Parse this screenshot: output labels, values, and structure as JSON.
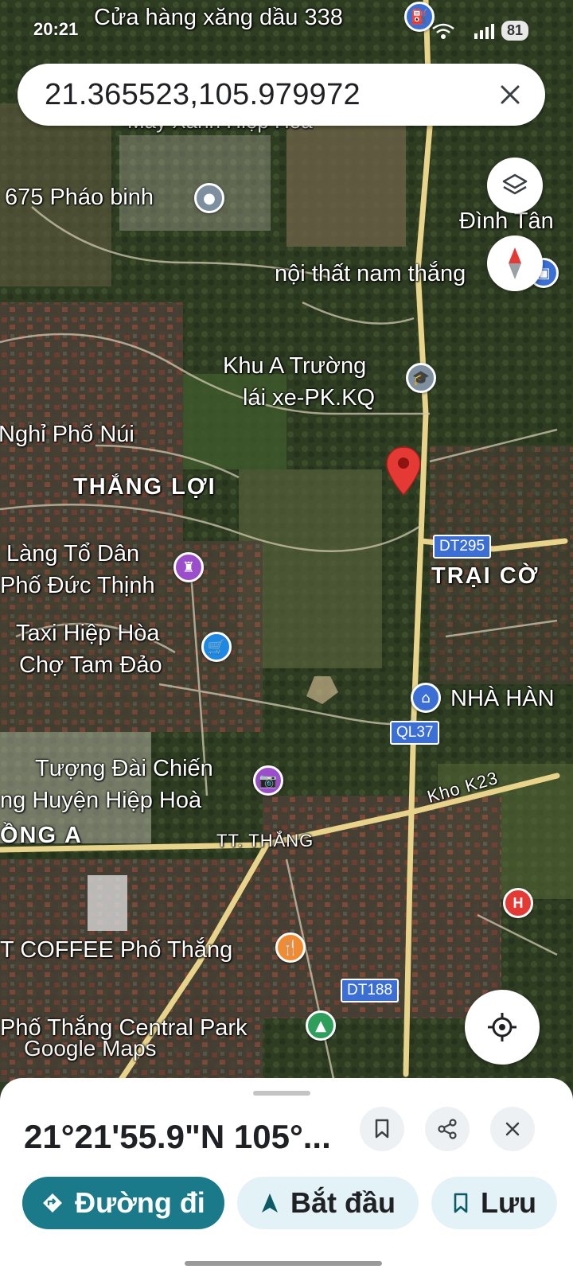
{
  "status": {
    "time": "20:21",
    "battery": "81"
  },
  "search": {
    "query": "21.365523,105.979972"
  },
  "map": {
    "watermark": "Google Maps",
    "labels": {
      "gas_station": "Cửa hàng xăng dầu 338",
      "may_xanh": "Máy Xanh Hiệp Hòa",
      "phao_binh": "675 Pháo binh",
      "dinh_tan": "Đình Tân",
      "noi_that": "nội thất nam thắng",
      "khu_a_line1": "Khu A Trường",
      "khu_a_line2": "lái xe-PK.KQ",
      "nghi_pho_nui": "Nghỉ Phố Núi",
      "thang_loi": "THẮNG LỢI",
      "lang_to_dan_line1": "Làng Tổ Dân",
      "lang_to_dan_line2": "Phố Đức Thịnh",
      "trai_co": "TRẠI CỜ",
      "taxi": "Taxi Hiệp Hòa",
      "cho_tam_dao": "Chợ Tam Đảo",
      "nha_hang": "NHÀ HÀN",
      "tuong_dai_line1": "Tượng Đài Chiến",
      "tuong_dai_line2": "ng Huyện Hiệp Hoà",
      "ong_a": "ỒNG A",
      "tt_thang": "TT. THẮNG",
      "kho_k23": "Kho K23",
      "coffee": "T COFFEE Phố Thắng",
      "central_park": "Phố Thắng Central Park"
    },
    "shields": {
      "dt295": "DT295",
      "ql37": "QL37",
      "dt188": "DT188"
    },
    "hospital_letter": "H"
  },
  "sheet": {
    "coordinates": "21°21'55.9\"N 105°...",
    "buttons": {
      "directions": "Đường đi",
      "start": "Bắt đầu",
      "save": "Lưu"
    }
  },
  "colors": {
    "accent": "#1a7a8a",
    "pill_light": "#e3f2f7",
    "start_icon": "#0b5a66",
    "pin_red": "#e53935"
  }
}
